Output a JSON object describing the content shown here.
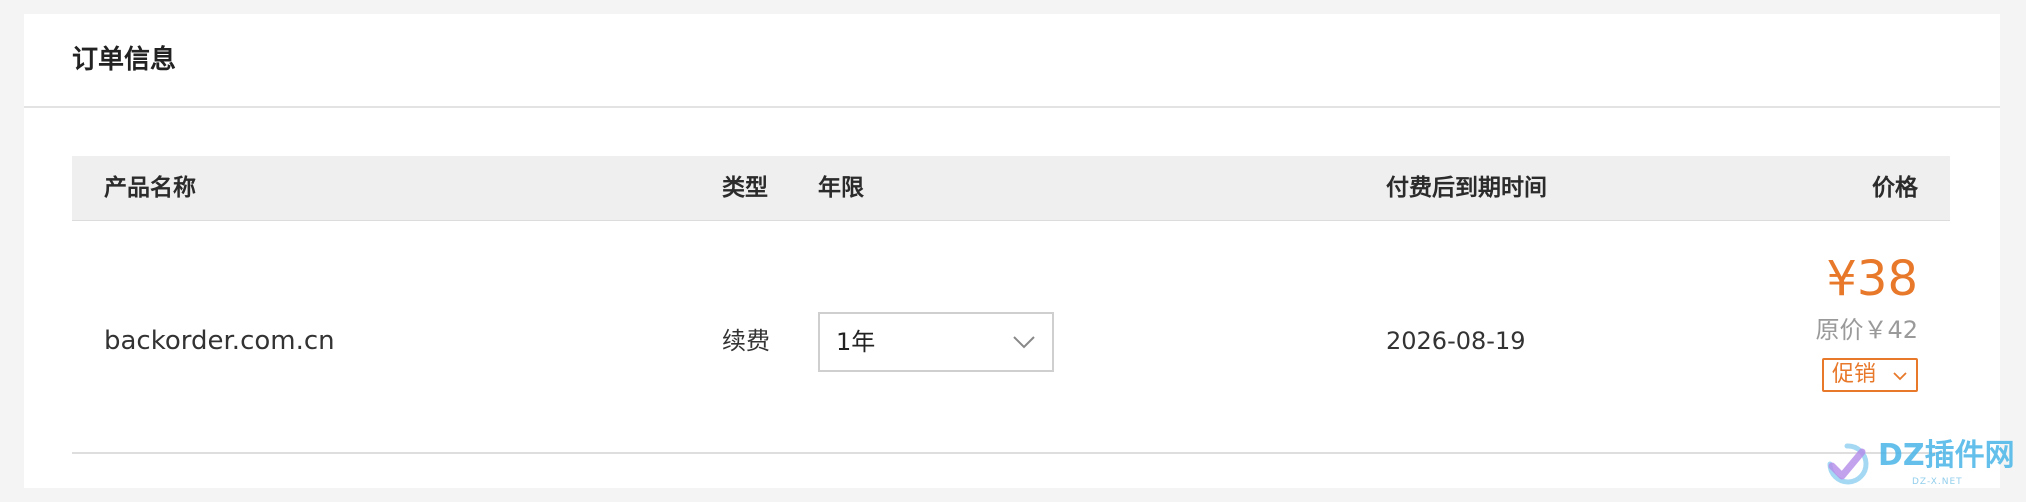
{
  "panel": {
    "title": "订单信息"
  },
  "table": {
    "headers": {
      "name": "产品名称",
      "type": "类型",
      "years": "年限",
      "expiry": "付费后到期时间",
      "price": "价格"
    },
    "rows": [
      {
        "name": "backorder.com.cn",
        "type": "续费",
        "years_selected": "1年",
        "expiry": "2026-08-19",
        "price_current": "¥38",
        "price_original": "原价￥42",
        "promo_label": "促销"
      }
    ]
  },
  "watermark": {
    "text": "DZ插件网",
    "subtext": "DZ-X.NET"
  },
  "colors": {
    "accent": "#e8782a",
    "header_bg": "#efefef",
    "page_bg": "#f4f4f4"
  },
  "icons": {
    "select_arrow": "chevron-down-icon",
    "promo_arrow": "chevron-down-icon",
    "watermark_logo": "dz-check-logo-icon"
  }
}
